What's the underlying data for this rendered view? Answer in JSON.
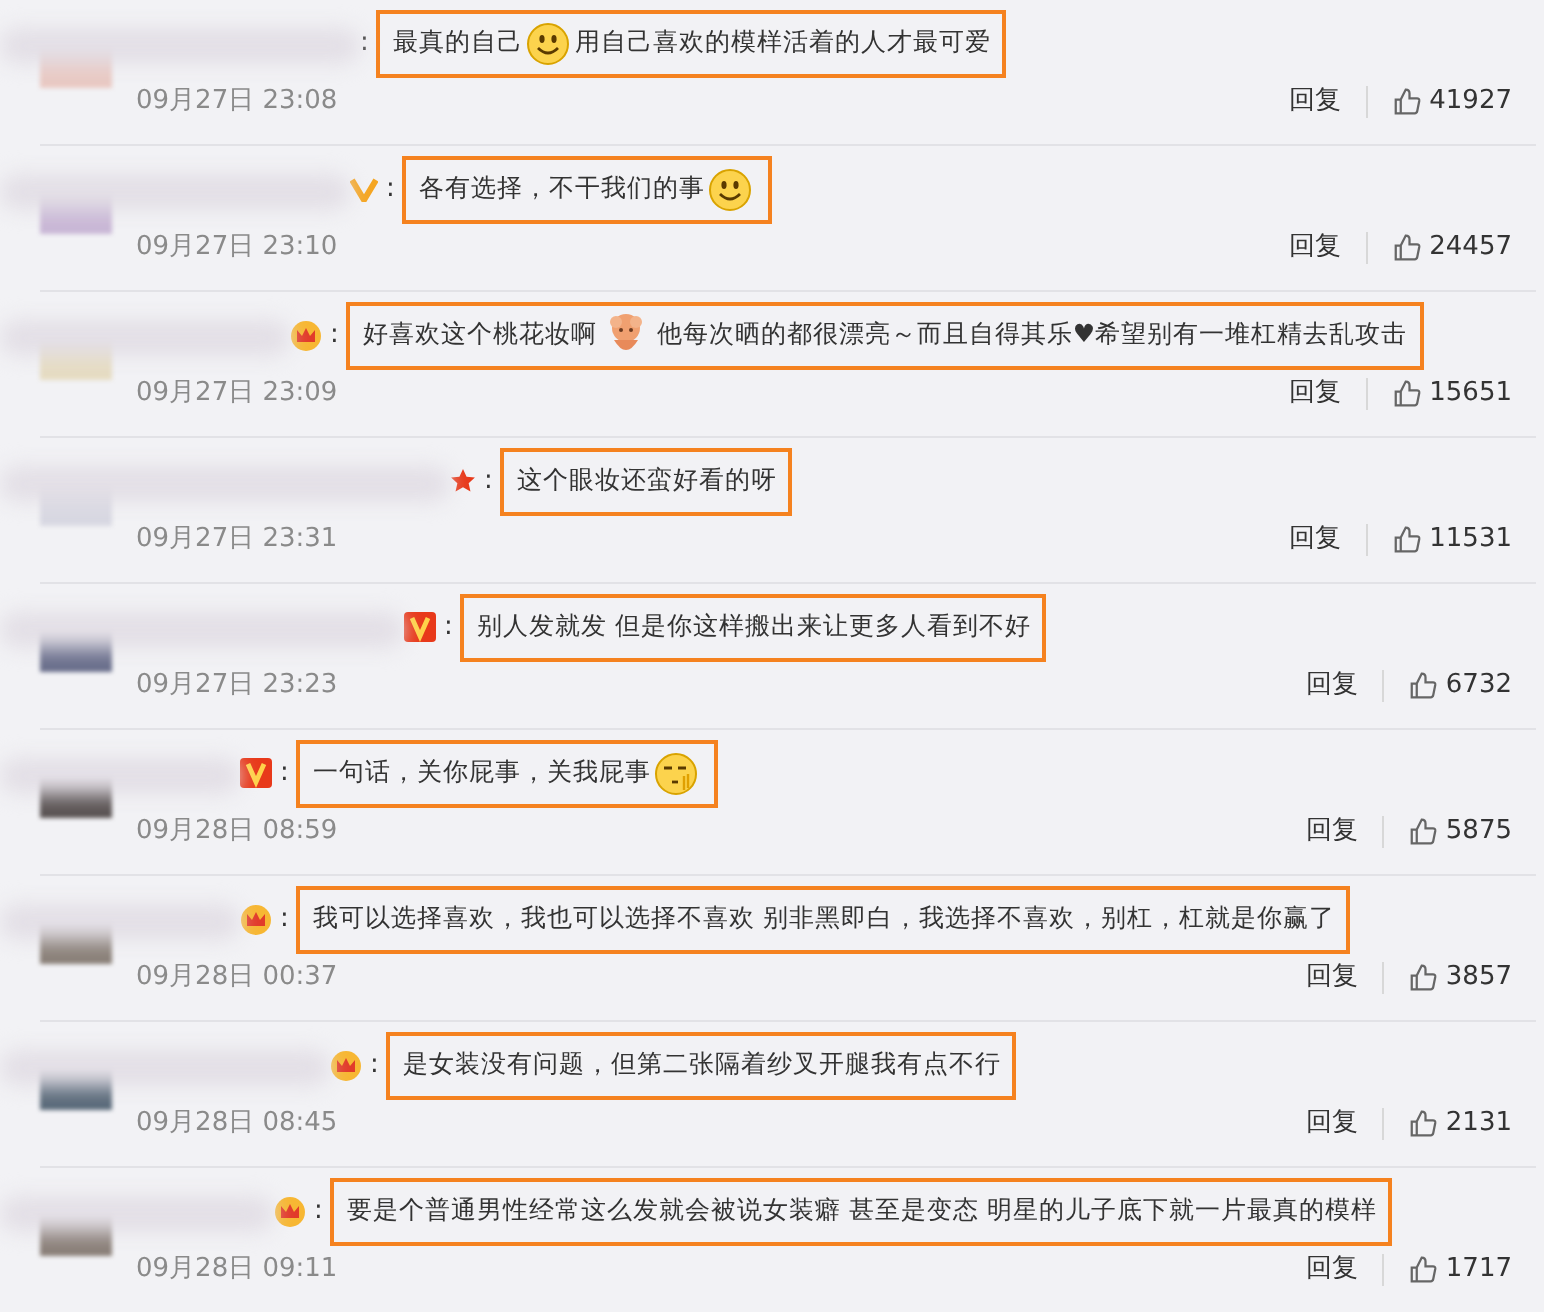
{
  "comments": [
    {
      "colon": ":",
      "parts": [
        {
          "kind": "text",
          "text": "最真的自己"
        },
        {
          "kind": "smile"
        },
        {
          "kind": "text",
          "text": "用自己喜欢的模样活着的人才最可爱"
        }
      ],
      "time": "09月27日 23:08",
      "reply": "回复",
      "likes": "41927"
    },
    {
      "badge": {
        "kind": "v-gold"
      },
      "colon": ":",
      "parts": [
        {
          "kind": "text",
          "text": "各有选择，不干我们的事"
        },
        {
          "kind": "smile"
        }
      ],
      "time": "09月27日 23:10",
      "reply": "回复",
      "likes": "24457"
    },
    {
      "badge": {
        "kind": "crown"
      },
      "colon": ":",
      "parts": [
        {
          "kind": "text",
          "text": "好喜欢这个桃花妆啊"
        },
        {
          "kind": "cartoon"
        },
        {
          "kind": "text",
          "text": "他每次晒的都很漂亮～而且自得其乐♥希望别有一堆杠精去乱攻击"
        }
      ],
      "time": "09月27日 23:09",
      "reply": "回复",
      "likes": "15651"
    },
    {
      "badge": {
        "kind": "star"
      },
      "colon": ":",
      "parts": [
        {
          "kind": "text",
          "text": "这个眼妆还蛮好看的呀"
        }
      ],
      "time": "09月27日 23:31",
      "reply": "回复",
      "likes": "11531"
    },
    {
      "badge": {
        "kind": "v-red"
      },
      "colon": ":",
      "parts": [
        {
          "kind": "text",
          "text": "别人发就发 但是你这样搬出来让更多人看到不好"
        }
      ],
      "time": "09月27日 23:23",
      "reply": "回复",
      "likes": "6732"
    },
    {
      "badge": {
        "kind": "v-red"
      },
      "colon": ":",
      "parts": [
        {
          "kind": "text",
          "text": "一句话，关你屁事，关我屁事"
        },
        {
          "kind": "shy"
        }
      ],
      "time": "09月28日 08:59",
      "reply": "回复",
      "likes": "5875"
    },
    {
      "badge": {
        "kind": "crown"
      },
      "colon": ":",
      "parts": [
        {
          "kind": "text",
          "text": "我可以选择喜欢，我也可以选择不喜欢 别非黑即白，我选择不喜欢，别杠，杠就是你赢了"
        }
      ],
      "time": "09月28日 00:37",
      "reply": "回复",
      "likes": "3857"
    },
    {
      "badge": {
        "kind": "crown"
      },
      "colon": ":",
      "parts": [
        {
          "kind": "text",
          "text": "是女装没有问题，但第二张隔着纱叉开腿我有点不行"
        }
      ],
      "time": "09月28日 08:45",
      "reply": "回复",
      "likes": "2131"
    },
    {
      "badge": {
        "kind": "crown"
      },
      "colon": ":",
      "parts": [
        {
          "kind": "text",
          "text": "要是个普通男性经常这么发就会被说女装癖 甚至是变态 明星的儿子底下就一片最真的模样"
        }
      ],
      "time": "09月28日 09:11",
      "reply": "回复",
      "likes": "1717"
    }
  ]
}
